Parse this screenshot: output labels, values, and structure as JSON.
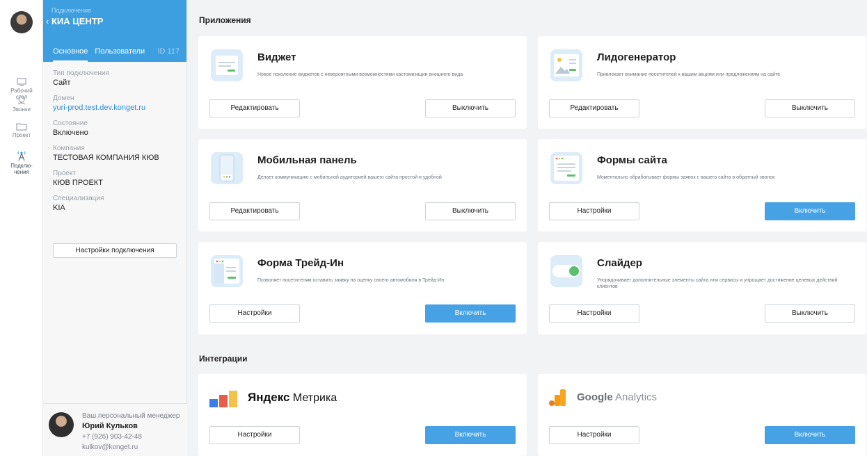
{
  "rail": {
    "items": [
      {
        "label_1": "Рабочий",
        "label_2": "стол"
      },
      {
        "label_1": "Звонки",
        "label_2": ""
      },
      {
        "label_1": "Проект",
        "label_2": ""
      },
      {
        "label_1": "Подклю-",
        "label_2": "чения"
      }
    ]
  },
  "panel": {
    "subtitle": "Подключение",
    "back_glyph": "‹",
    "title": "КИА ЦЕНТР",
    "tabs": {
      "main": "Основное",
      "users": "Пользователи",
      "id": "ID 117"
    },
    "fields": [
      {
        "label": "Тип подключения",
        "value": "Сайт"
      },
      {
        "label": "Домен",
        "value": "yuri-prod.test.dev.konget.ru"
      },
      {
        "label": "Состояние",
        "value": "Включено"
      },
      {
        "label": "Компания",
        "value": "ТЕСТОВАЯ КОМПАНИЯ КЮВ"
      },
      {
        "label": "Проект",
        "value": "КЮВ ПРОЕКТ"
      },
      {
        "label": "Специализация",
        "value": "KIA"
      }
    ],
    "settings_button": "Настройки подключения",
    "manager": {
      "caption": "Ваш персональный менеджер",
      "name": "Юрий Кульков",
      "phone": "+7 (926) 903-42-48",
      "email": "kulkov@konget.ru"
    }
  },
  "apps": {
    "title": "Приложения",
    "cards": [
      {
        "name": "Виджет",
        "desc": "Новое поколение виджетов с невероятными возможностями кастомизации внешнего вида",
        "left_btn": "Редактировать",
        "right_btn": "Выключить",
        "right_primary": false,
        "icon": "widget-icon"
      },
      {
        "name": "Лидогенератор",
        "desc": "Привлекает внимание посетителей к вашим акциям или предложениям на сайте",
        "left_btn": "Редактировать",
        "right_btn": "Выключить",
        "right_primary": false,
        "icon": "leadgen-icon"
      },
      {
        "name": "Мобильная панель",
        "desc": "Делает коммуникацию с мобильной аудиторией вашего сайта простой и удобной",
        "left_btn": "Редактировать",
        "right_btn": "Выключить",
        "right_primary": false,
        "icon": "mobile-panel-icon"
      },
      {
        "name": "Формы сайта",
        "desc": "Моментально обрабатывает формы заявок с вашего сайта в обратный звонок",
        "left_btn": "Настройки",
        "right_btn": "Включить",
        "right_primary": true,
        "icon": "site-forms-icon"
      },
      {
        "name": "Форма Трейд-Ин",
        "desc": "Позволяет посетителям оставить заявку на оценку своего автомобиля в Трейд-Ин",
        "left_btn": "Настройки",
        "right_btn": "Включить",
        "right_primary": true,
        "icon": "trade-in-form-icon"
      },
      {
        "name": "Слайдер",
        "desc": "Упорядочивает дополнительные элементы сайта или сервисы и упрощает достижение целевых действий клиентов",
        "left_btn": "Настройки",
        "right_btn": "Выключить",
        "right_primary": false,
        "icon": "slider-icon"
      }
    ]
  },
  "integrations": {
    "title": "Интеграции",
    "cards": [
      {
        "logo_part1": "Яндекс",
        "logo_part2": " Метрика",
        "left_btn": "Настройки",
        "right_btn": "Включить",
        "icon": "yandex-metrika-logo"
      },
      {
        "logo_part1": "Google",
        "logo_part2": " Analytics",
        "left_btn": "Настройки",
        "right_btn": "Включить",
        "icon": "google-analytics-logo"
      }
    ]
  },
  "colors": {
    "accent": "#3d9fe0",
    "primary_button": "#46a2e4",
    "link": "#2f8fd6"
  }
}
